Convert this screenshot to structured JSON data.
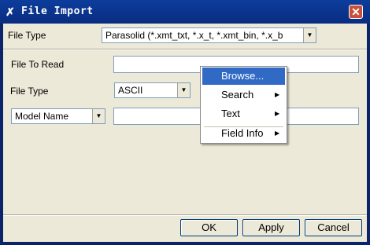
{
  "window": {
    "title": "File Import",
    "app_icon": "tools-icon",
    "close_glyph": "✕"
  },
  "top_row": {
    "label": "File Type",
    "value": "Parasolid (*.xmt_txt, *.x_t, *.xmt_bin, *.x_b"
  },
  "file_to_read": {
    "label": "File To Read",
    "value": ""
  },
  "file_type_2": {
    "label": "File Type",
    "value": "ASCII"
  },
  "model_name": {
    "option": "Model Name",
    "value": ""
  },
  "buttons": {
    "ok": "OK",
    "apply": "Apply",
    "cancel": "Cancel"
  },
  "context_menu": {
    "items": [
      {
        "label": "Browse...",
        "submenu": false,
        "highlighted": true
      },
      {
        "label": "Search",
        "submenu": true,
        "highlighted": false
      },
      {
        "label": "Text",
        "submenu": true,
        "highlighted": false
      },
      {
        "label": "Field Info",
        "submenu": true,
        "highlighted": false
      }
    ],
    "submenu_glyph": "▶",
    "highlight_color": "#316ac5"
  },
  "colors": {
    "titlebar": "#0a246a",
    "face": "#ece9d8",
    "close": "#c8503a"
  }
}
